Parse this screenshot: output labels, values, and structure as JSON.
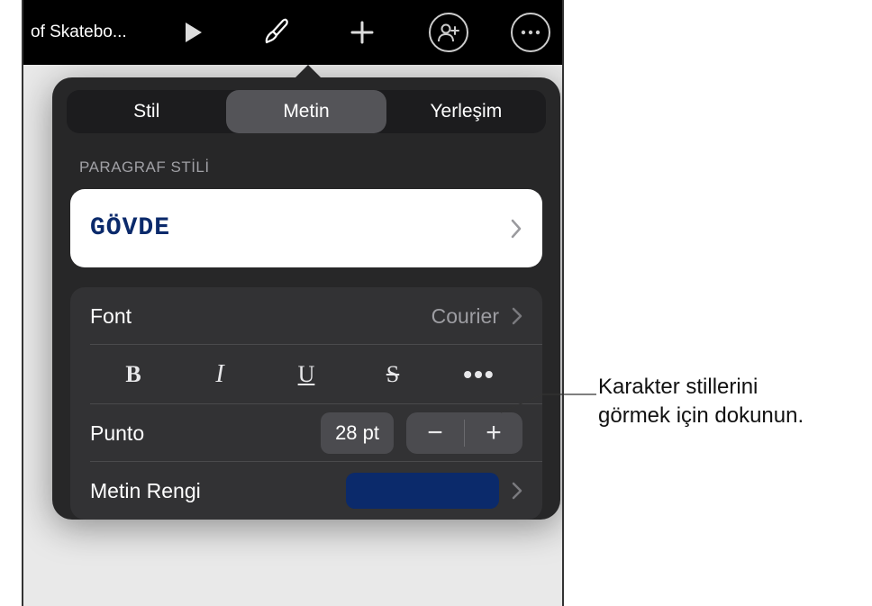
{
  "toolbar": {
    "doc_title": "of Skatebo..."
  },
  "tabs": {
    "style": "Stil",
    "text": "Metin",
    "layout": "Yerleşim"
  },
  "paragraph": {
    "label": "PARAGRAF STİLİ",
    "value": "GÖVDE"
  },
  "font": {
    "label": "Font",
    "value": "Courier"
  },
  "format": {
    "bold": "B",
    "italic": "I",
    "underline": "U",
    "strike": "S",
    "more": "•••"
  },
  "size": {
    "label": "Punto",
    "value": "28 pt",
    "minus": "−",
    "plus": "+"
  },
  "color": {
    "label": "Metin Rengi",
    "hex": "#0b2a6b"
  },
  "callout": {
    "line1": "Karakter stillerini",
    "line2": "görmek için dokunun."
  }
}
